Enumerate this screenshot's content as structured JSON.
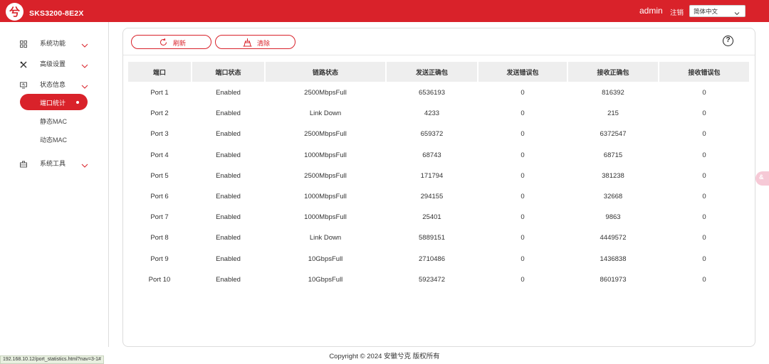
{
  "header": {
    "logo_glyph": "兮",
    "brand": "SKS3200-8E2X",
    "user": "admin",
    "logout": "注销",
    "language": "简体中文",
    "accent": "#d9222a"
  },
  "sidebar": {
    "items": [
      {
        "label": "系统功能",
        "icon": "grid-icon",
        "expanded": false
      },
      {
        "label": "高级设置",
        "icon": "tools-icon",
        "expanded": false
      },
      {
        "label": "状态信息",
        "icon": "monitor-icon",
        "expanded": true
      },
      {
        "label": "系统工具",
        "icon": "toolbox-icon",
        "expanded": false
      }
    ],
    "subitems": [
      {
        "label": "端口统计",
        "active": true
      },
      {
        "label": "静态MAC",
        "active": false
      },
      {
        "label": "动态MAC",
        "active": false
      }
    ]
  },
  "toolbar": {
    "refresh_label": "刷新",
    "clear_label": "清除",
    "help_glyph": "?"
  },
  "table": {
    "columns": [
      "端口",
      "端口状态",
      "链路状态",
      "发送正确包",
      "发送错误包",
      "接收正确包",
      "接收错误包"
    ],
    "rows": [
      [
        "Port 1",
        "Enabled",
        "2500MbpsFull",
        "6536193",
        "0",
        "816392",
        "0"
      ],
      [
        "Port 2",
        "Enabled",
        "Link Down",
        "4233",
        "0",
        "215",
        "0"
      ],
      [
        "Port 3",
        "Enabled",
        "2500MbpsFull",
        "659372",
        "0",
        "6372547",
        "0"
      ],
      [
        "Port 4",
        "Enabled",
        "1000MbpsFull",
        "68743",
        "0",
        "68715",
        "0"
      ],
      [
        "Port 5",
        "Enabled",
        "2500MbpsFull",
        "171794",
        "0",
        "381238",
        "0"
      ],
      [
        "Port 6",
        "Enabled",
        "1000MbpsFull",
        "294155",
        "0",
        "32668",
        "0"
      ],
      [
        "Port 7",
        "Enabled",
        "1000MbpsFull",
        "25401",
        "0",
        "9863",
        "0"
      ],
      [
        "Port 8",
        "Enabled",
        "Link Down",
        "5889151",
        "0",
        "4449572",
        "0"
      ],
      [
        "Port 9",
        "Enabled",
        "10GbpsFull",
        "2710486",
        "0",
        "1436838",
        "0"
      ],
      [
        "Port 10",
        "Enabled",
        "10GbpsFull",
        "5923472",
        "0",
        "8601973",
        "0"
      ]
    ]
  },
  "footer": {
    "copyright": "Copyright © 2024 安徽兮克 版权所有"
  },
  "statusbar": {
    "url": "192.168.10.12/port_statistics.html?nav=3-1#"
  },
  "float_tab": {
    "glyph": "&"
  }
}
